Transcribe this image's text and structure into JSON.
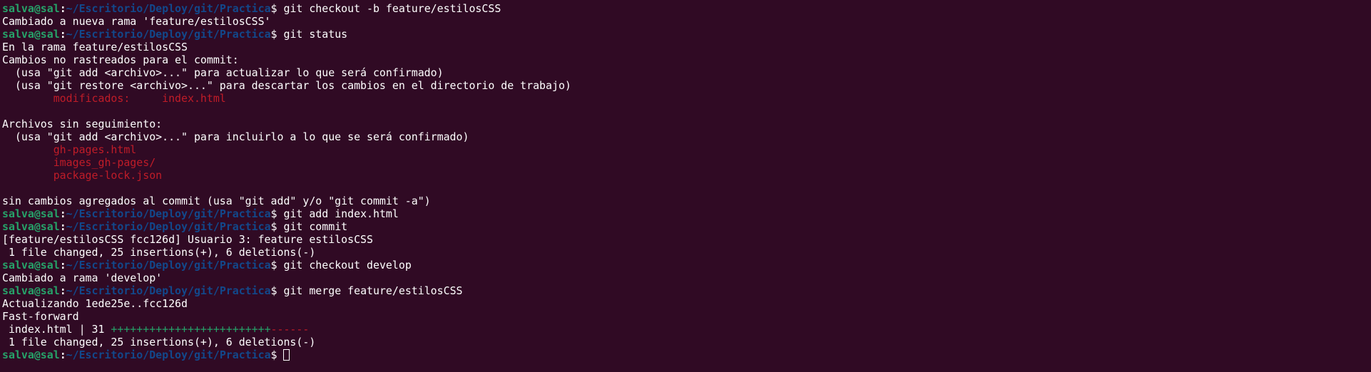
{
  "prompt": {
    "user": "salva@sal",
    "colon": ":",
    "path": "~/Escritorio/Deploy/git/Practica",
    "dollar": "$ "
  },
  "colors": {
    "background": "#300a24",
    "user": "#26a269",
    "path": "#12488b",
    "text": "#ffffff",
    "untracked": "#c01c28",
    "added": "#26a269",
    "removed": "#c01c28"
  },
  "lines": [
    {
      "type": "prompt",
      "cmd": "git checkout -b feature/estilosCSS"
    },
    {
      "type": "out",
      "text": "Cambiado a nueva rama 'feature/estilosCSS'"
    },
    {
      "type": "prompt",
      "cmd": "git status"
    },
    {
      "type": "out",
      "text": "En la rama feature/estilosCSS"
    },
    {
      "type": "out",
      "text": "Cambios no rastreados para el commit:"
    },
    {
      "type": "out",
      "text": "  (usa \"git add <archivo>...\" para actualizar lo que será confirmado)"
    },
    {
      "type": "out",
      "text": "  (usa \"git restore <archivo>...\" para descartar los cambios en el directorio de trabajo)"
    },
    {
      "type": "red",
      "text": "        modificados:     index.html"
    },
    {
      "type": "out",
      "text": ""
    },
    {
      "type": "out",
      "text": "Archivos sin seguimiento:"
    },
    {
      "type": "out",
      "text": "  (usa \"git add <archivo>...\" para incluirlo a lo que se será confirmado)"
    },
    {
      "type": "red",
      "text": "        gh-pages.html"
    },
    {
      "type": "red",
      "text": "        images_gh-pages/"
    },
    {
      "type": "red",
      "text": "        package-lock.json"
    },
    {
      "type": "out",
      "text": ""
    },
    {
      "type": "out",
      "text": "sin cambios agregados al commit (usa \"git add\" y/o \"git commit -a\")"
    },
    {
      "type": "prompt",
      "cmd": "git add index.html"
    },
    {
      "type": "prompt",
      "cmd": "git commit"
    },
    {
      "type": "out",
      "text": "[feature/estilosCSS fcc126d] Usuario 3: feature estilosCSS"
    },
    {
      "type": "out",
      "text": " 1 file changed, 25 insertions(+), 6 deletions(-)"
    },
    {
      "type": "prompt",
      "cmd": "git checkout develop"
    },
    {
      "type": "out",
      "text": "Cambiado a rama 'develop'"
    },
    {
      "type": "prompt",
      "cmd": "git merge feature/estilosCSS"
    },
    {
      "type": "out",
      "text": "Actualizando 1ede25e..fcc126d"
    },
    {
      "type": "out",
      "text": "Fast-forward"
    },
    {
      "type": "diffstat",
      "text": " index.html | 31 ",
      "plus": "+++++++++++++++++++++++++",
      "minus": "------"
    },
    {
      "type": "out",
      "text": " 1 file changed, 25 insertions(+), 6 deletions(-)"
    },
    {
      "type": "prompt",
      "cmd": "",
      "cursor": true
    }
  ]
}
